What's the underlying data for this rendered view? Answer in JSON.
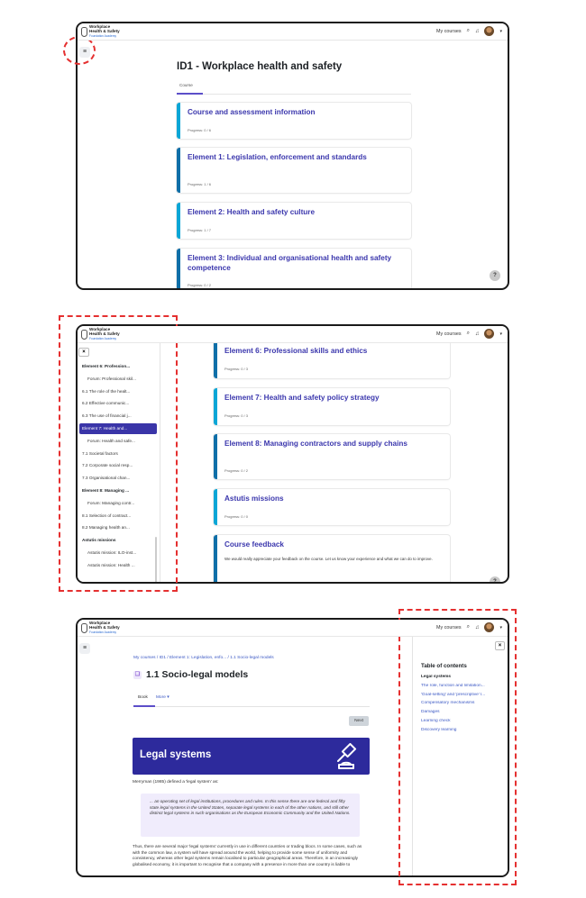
{
  "brand": {
    "line1": "Workplace",
    "line2": "Health & Safety",
    "line3": "Foundation Academy"
  },
  "nav": {
    "my_courses": "My courses"
  },
  "course": {
    "title": "ID1 - Workplace health and safety",
    "tab": "Course",
    "sections": [
      {
        "title": "Course and assessment information",
        "progress": "Progress: 0 / 6"
      },
      {
        "title": "Element 1: Legislation, enforcement and standards",
        "progress": "Progress: 1 / 6"
      },
      {
        "title": "Element 2: Health and safety culture",
        "progress": "Progress: 1 / 7"
      },
      {
        "title": "Element 3: Individual and organisational health and safety competence",
        "progress": "Progress: 0 / 2"
      }
    ],
    "sections2": [
      {
        "title": "Element 6: Professional skills and ethics",
        "progress": "Progress: 0 / 3"
      },
      {
        "title": "Element 7: Health and safety policy strategy",
        "progress": "Progress: 0 / 3"
      },
      {
        "title": "Element 8: Managing contractors and supply chains",
        "progress": "Progress: 0 / 2"
      },
      {
        "title": "Astutis missions",
        "progress": "Progress: 0 / 0"
      },
      {
        "title": "Course feedback",
        "body": "We would really appreciate your feedback on the course. Let us know your experience and what we can do to improve."
      }
    ]
  },
  "drawer": {
    "items": [
      {
        "label": "Element 6: Profession...",
        "kind": "sec"
      },
      {
        "label": "Forum: Professional skil...",
        "kind": "sub"
      },
      {
        "label": "6.1 The role of the healt...",
        "kind": "item"
      },
      {
        "label": "6.2 Effective communic...",
        "kind": "item"
      },
      {
        "label": "6.3 The use of financial j...",
        "kind": "item"
      },
      {
        "label": "Element 7: Health and...",
        "kind": "act"
      },
      {
        "label": "Forum: Health and safe...",
        "kind": "sub"
      },
      {
        "label": "7.1 Societal factors",
        "kind": "item"
      },
      {
        "label": "7.2 Corporate social resp...",
        "kind": "item"
      },
      {
        "label": "7.3 Organisational chan...",
        "kind": "item"
      },
      {
        "label": "Element 8: Managing ...",
        "kind": "sec"
      },
      {
        "label": "Forum: Managing contr...",
        "kind": "sub"
      },
      {
        "label": "8.1 Selection of contract...",
        "kind": "item"
      },
      {
        "label": "8.2 Managing health an...",
        "kind": "item"
      },
      {
        "label": "Astutis missions",
        "kind": "sec"
      },
      {
        "label": "Astutis mission: ILO-inst...",
        "kind": "sub"
      },
      {
        "label": "Astutis mission: Health ...",
        "kind": "sub"
      }
    ]
  },
  "book": {
    "breadcrumb": "My courses  /  ID1  /  Element 1: Legislation, enfo...  /  1.1 Socio-legal models",
    "title": "1.1 Socio-legal models",
    "tab_book": "Book",
    "tab_more": "More ▾",
    "next": "Next",
    "banner": "Legal systems",
    "intro": "Merryman (1985) defined a 'legal system' as:",
    "quote": "... an operating set of legal institutions, procedures and rules. In this sense there are one federal and fifty state legal systems in the United States, separate legal systems in each of the other nations, and still other distinct legal systems in such organisations as the European Economic Community and the United Nations.",
    "para": "Thus, there are several major 'legal systems' currently in use in different countries or trading blocs. In some cases, such as with the common law, a system will have spread around the world, helping to provide some sense of uniformity and consistency, whereas other legal systems remain localised to particular geographical areas. Therefore, in an increasingly globalised economy, it is important to recognise that a company with a presence in more than one country is liable to"
  },
  "toc": {
    "heading": "Table of contents",
    "items": [
      {
        "label": "Legal systems",
        "current": true
      },
      {
        "label": "The role, function and limitation...",
        "current": false
      },
      {
        "label": "'Goal-setting' and 'prescriptive' l...",
        "current": false
      },
      {
        "label": "Compensatory mechanisms",
        "current": false
      },
      {
        "label": "Damages",
        "current": false
      },
      {
        "label": "Learning check",
        "current": false
      },
      {
        "label": "Discovery learning",
        "current": false
      }
    ]
  },
  "icons": {
    "help": "?",
    "close": "×",
    "drawer": "≡"
  },
  "colors": {
    "accent": "#3b37ad",
    "active": "#3a35a8",
    "highlight": "#e53030"
  }
}
